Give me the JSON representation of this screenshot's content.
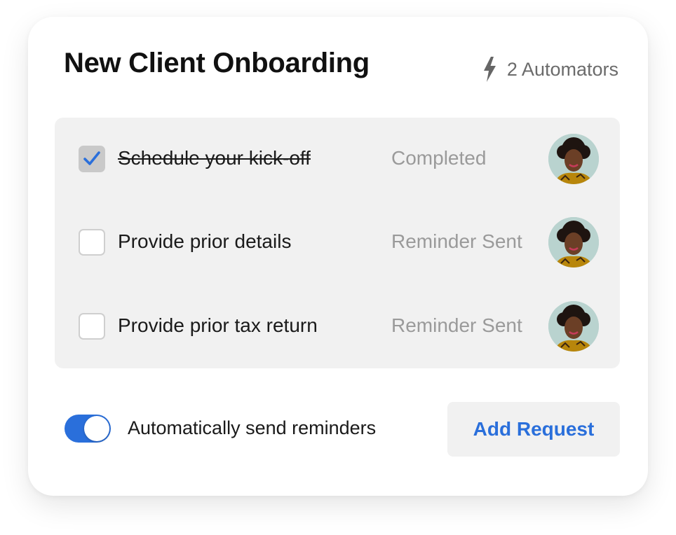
{
  "card": {
    "title": "New Client Onboarding",
    "automators": {
      "icon": "lightning-bolt-icon",
      "label": "2 Automators"
    }
  },
  "tasks": [
    {
      "label": "Schedule your kick-off",
      "status": "Completed",
      "checked": true
    },
    {
      "label": "Provide prior details",
      "status": "Reminder Sent",
      "checked": false
    },
    {
      "label": "Provide prior tax return",
      "status": "Reminder Sent",
      "checked": false
    }
  ],
  "footer": {
    "toggle_on": true,
    "toggle_label": "Automatically send reminders",
    "add_button_label": "Add Request"
  },
  "colors": {
    "accent": "#2a6fdb",
    "panel_bg": "#f1f1f1",
    "status_text": "#9a9a9a"
  }
}
